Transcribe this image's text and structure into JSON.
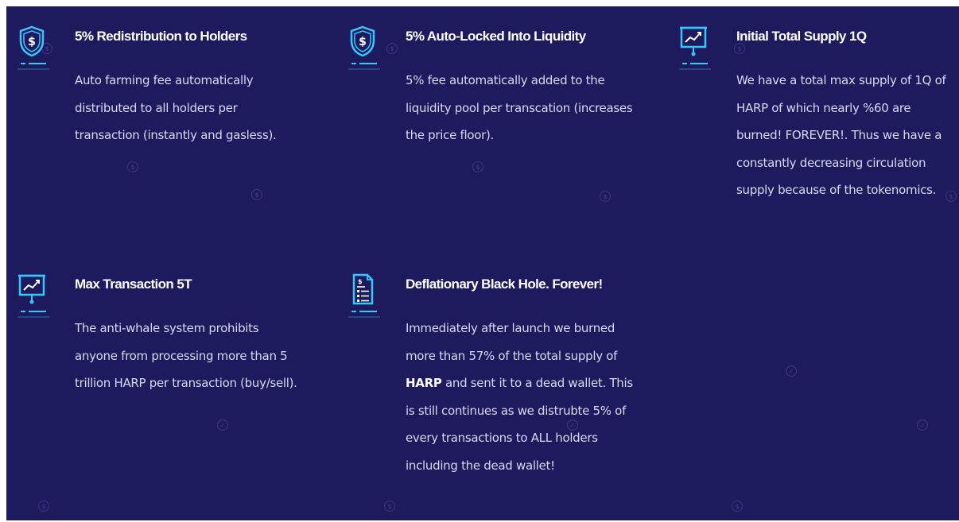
{
  "colors": {
    "background": "#1e1a5e",
    "accent": "#35c8ff",
    "text": "#d8d8ef",
    "title": "#ffffff"
  },
  "features": [
    {
      "icon": "shield-dollar-icon",
      "title": "5% Redistribution to Holders",
      "description": "Auto farming fee automatically distributed to all holders per transaction (instantly and gasless)."
    },
    {
      "icon": "shield-dollar-icon",
      "title": "5% Auto-Locked Into Liquidity",
      "description": "5% fee automatically added to the liquidity pool per transcation (increases the price floor)."
    },
    {
      "icon": "chart-board-icon",
      "title": "Initial Total Supply 1Q",
      "description": "We have a total max supply of 1Q of HARP of which nearly %60 are burned! FOREVER!. Thus we have a constantly decreasing circulation supply because of the tokenomics."
    },
    {
      "icon": "chart-board-icon",
      "title": "Max Transaction 5T",
      "description": "The anti-whale system prohibits anyone from processing more than 5 trillion HARP per transaction (buy/sell)."
    },
    {
      "icon": "document-dollar-icon",
      "title": "Deflationary Black Hole. Forever!",
      "description_before": "Immediately after launch we burned more than 57% of the total supply of",
      "description_bold": "HARP",
      "description_after": "and sent it to a dead wallet. This is still continues as we distrubte 5% of every transactions to ALL holders including the dead wallet!"
    }
  ]
}
